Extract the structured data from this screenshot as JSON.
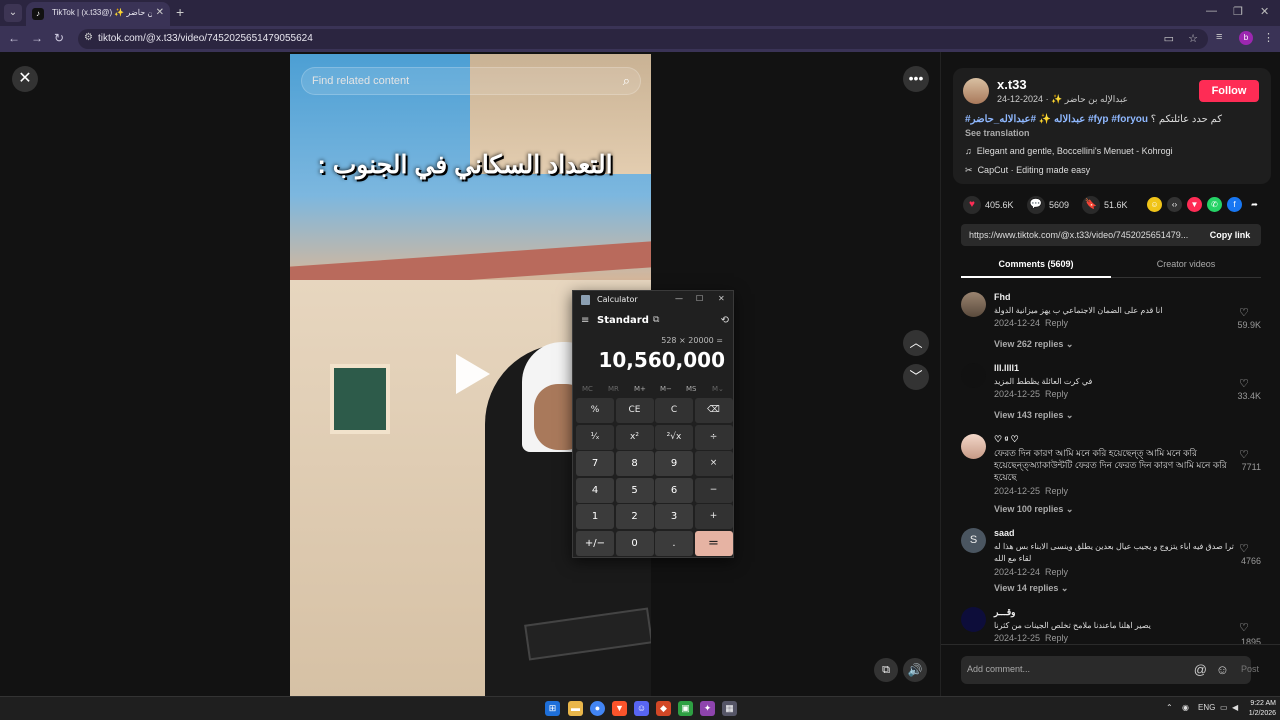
{
  "browser": {
    "tab_title": "TikTok | (x.t33@) ✨ عبدالإله بن حاضر",
    "url": "tiktok.com/@x.t33/video/7452025651479055624",
    "profile_initial": "b"
  },
  "video": {
    "search_placeholder": "Find related content",
    "caption": "التعداد السكاني في الجنوب :"
  },
  "post": {
    "username": "x.t33",
    "display_name": "عبدالإله بن حاضر ✨",
    "date": "2024-12-24",
    "follow_label": "Follow",
    "desc_text": "كم حدد عائلتكم ؟",
    "hashtags": [
      "#عبدالاله ✨",
      "#عبدالاله_حاضر",
      "#fyp",
      "#foryou"
    ],
    "see_translation": "See translation",
    "music": "Elegant and gentle, Boccellini's Menuet - Kohrogi",
    "capcut": "CapCut · Editing made easy",
    "likes": "405.6K",
    "comments": "5609",
    "saves": "51.6K",
    "link": "https://www.tiktok.com/@x.t33/video/7452025651479...",
    "copy_link": "Copy link",
    "tab_comments": "Comments (5609)",
    "tab_creator": "Creator videos"
  },
  "comments": [
    {
      "name": "Fhd",
      "initial": "",
      "text": "انا قدم على الضمان الاجتماعي ب يهز ميزانية الدولة",
      "date": "2024-12-24",
      "reply": "Reply",
      "view": "View 262 replies",
      "likes": "59.9K"
    },
    {
      "name": "lll.llll1",
      "initial": "",
      "text": "في كرت العائلة يظطط المزيد",
      "date": "2024-12-25",
      "reply": "Reply",
      "view": "View 143 replies",
      "likes": "33.4K"
    },
    {
      "name": "♡ ᵍ ♡",
      "initial": "",
      "text": "ফেরত দিন কারণ আমি মনে করি হয়েছেন্ত্ আমি মনে করি হয়েছেন্ত্অ্যাকাউন্টটি ফেরত দিন ফেরত দিন কারণ আমি মনে করি হয়েছে",
      "date": "2024-12-25",
      "reply": "Reply",
      "view": "View 100 replies",
      "likes": "7711"
    },
    {
      "name": "saad",
      "initial": "S",
      "text": "ترا صدق فيه اباء يتزوج و يجيب عيال بعدين يطلق وينسى الابناء بس هذا له لقاء مع الله",
      "date": "2024-12-24",
      "reply": "Reply",
      "view": "View 14 replies",
      "likes": "4766"
    },
    {
      "name": "وقـــر",
      "initial": "",
      "text": "يصير اهلنا ماعندنا ملامح تخلص الجينات من كثرنا",
      "date": "2024-12-25",
      "reply": "Reply",
      "view": "",
      "likes": "1895"
    }
  ],
  "comment_input": {
    "placeholder": "Add comment...",
    "post_label": "Post"
  },
  "calculator": {
    "title": "Calculator",
    "mode": "Standard",
    "expression": "528 × 20000 =",
    "result": "10,560,000",
    "memory": [
      "MC",
      "MR",
      "M+",
      "M−",
      "MS",
      "M⌄"
    ],
    "keys": [
      "%",
      "CE",
      "C",
      "⌫",
      "¹⁄ₓ",
      "x²",
      "²√x",
      "÷",
      "7",
      "8",
      "9",
      "×",
      "4",
      "5",
      "6",
      "−",
      "1",
      "2",
      "3",
      "+",
      "+/−",
      "0",
      ".",
      "="
    ]
  },
  "taskbar": {
    "lang": "ENG",
    "time": "9:22 AM",
    "date": "1/2/2026"
  },
  "colors": {
    "accent": "#fe2c55",
    "calc_equals": "#e6b3a3"
  }
}
